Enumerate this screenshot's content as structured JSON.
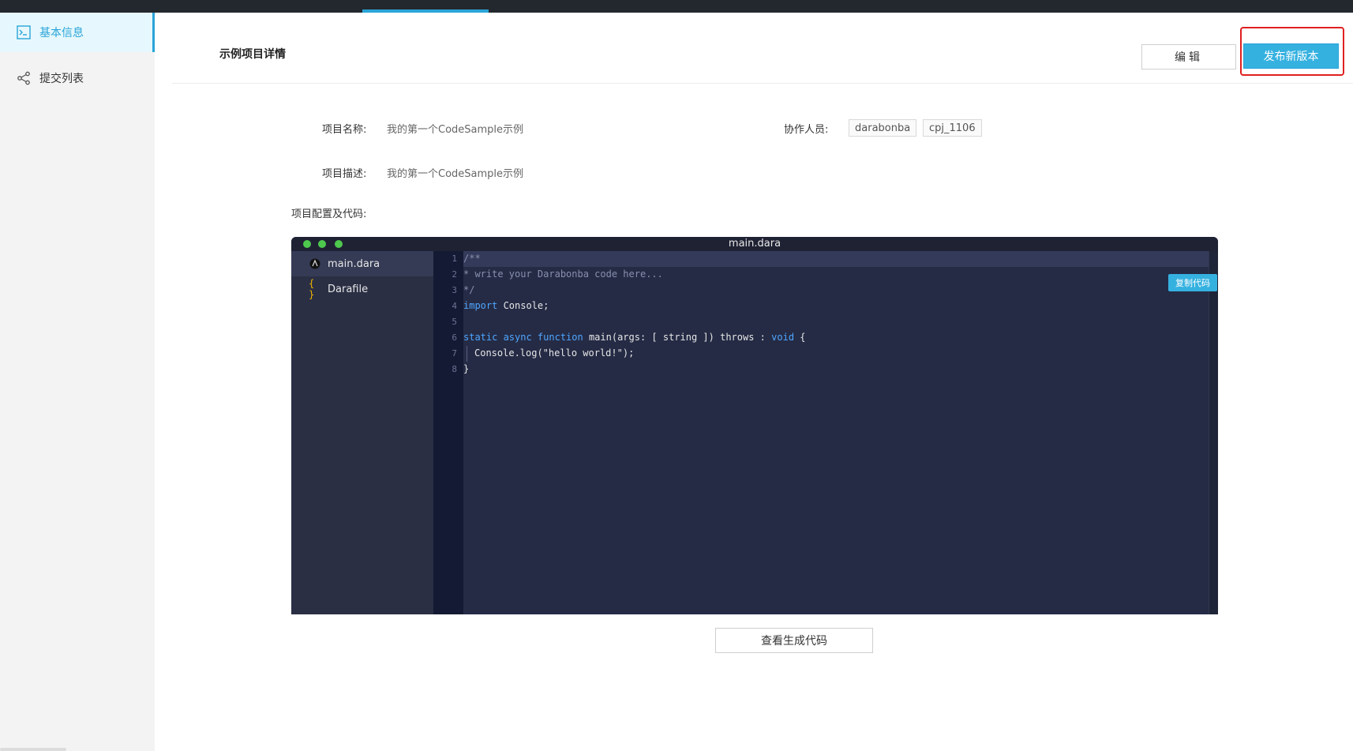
{
  "sidebar": {
    "items": [
      {
        "label": "基本信息",
        "icon": "terminal-icon",
        "active": true
      },
      {
        "label": "提交列表",
        "icon": "share-icon",
        "active": false
      }
    ]
  },
  "header": {
    "title": "示例项目详情",
    "edit_label": "编辑",
    "publish_label": "发布新版本"
  },
  "info": {
    "name_label": "项目名称:",
    "name_value": "我的第一个CodeSample示例",
    "desc_label": "项目描述:",
    "desc_value": "我的第一个CodeSample示例",
    "collaborators_label": "协作人员:",
    "collaborators": [
      "darabonba",
      "cpj_1106"
    ],
    "config_label": "项目配置及代码:"
  },
  "editor": {
    "title": "main.dara",
    "files": [
      {
        "name": "main.dara",
        "icon": "dara-file-icon"
      },
      {
        "name": "Darafile",
        "icon": "braces-icon"
      }
    ],
    "line_numbers": [
      "1",
      "2",
      "3",
      "4",
      "5",
      "6",
      "7",
      "8"
    ],
    "lines": {
      "l1": "/**",
      "l2": "* write your Darabonba code here...",
      "l3": "*/",
      "l4_kw": "import",
      "l4_rest": " Console;",
      "l6_kw1": "static async function",
      "l6_mid": " main(args: [ string ]) throws : ",
      "l6_kw2": "void",
      "l6_end": " {",
      "l7": "Console.log(\"hello world!\");",
      "l8": "}"
    },
    "copy_label": "复制代码"
  },
  "footer": {
    "view_code_label": "查看生成代码"
  },
  "colors": {
    "accent": "#35b1e0",
    "highlight": "#e02020",
    "editor_bg": "#252b45"
  }
}
